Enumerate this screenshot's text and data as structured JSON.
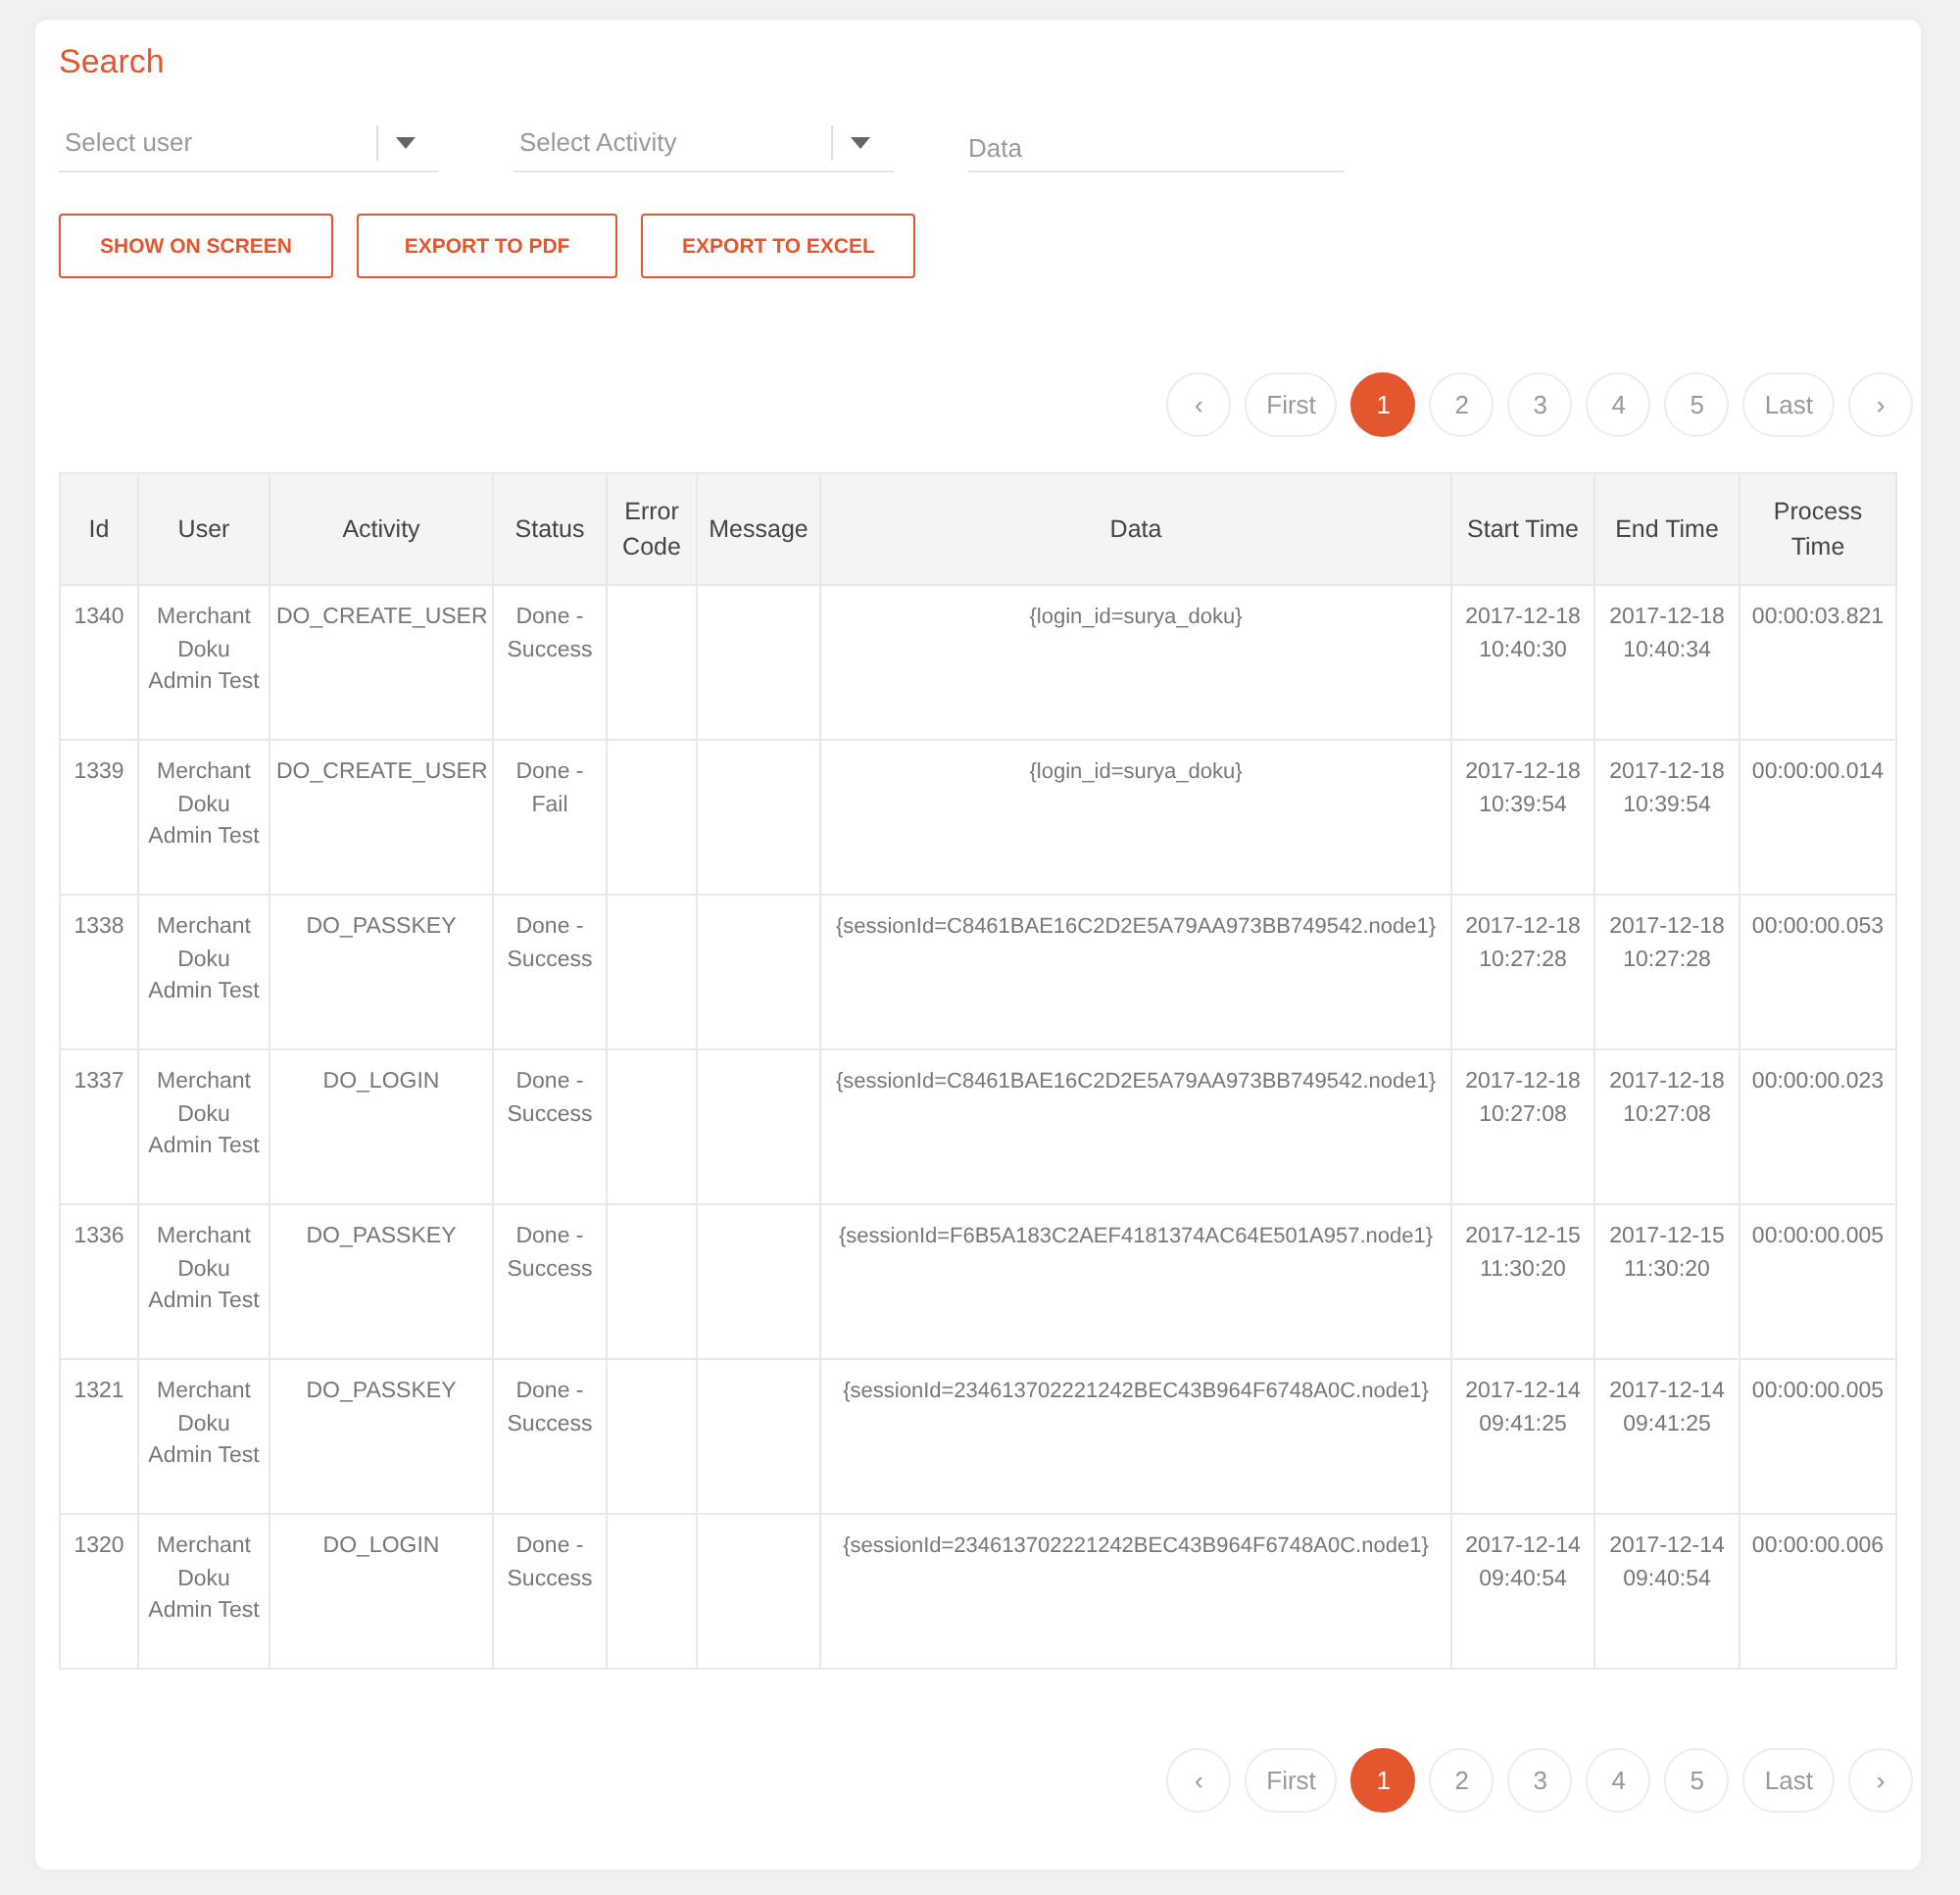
{
  "search": {
    "title": "Search",
    "fields": [
      {
        "kind": "select",
        "placeholder": "Select user"
      },
      {
        "kind": "select",
        "placeholder": "Select Activity"
      },
      {
        "kind": "text",
        "placeholder": "Data"
      }
    ],
    "buttons": [
      "SHOW ON SCREEN",
      "EXPORT TO PDF",
      "EXPORT TO EXCEL"
    ]
  },
  "pagination_top": [
    {
      "label": "‹",
      "selected": false
    },
    {
      "label": "First",
      "selected": false
    },
    {
      "label": "1",
      "selected": true
    },
    {
      "label": "2",
      "selected": false
    },
    {
      "label": "3",
      "selected": false
    },
    {
      "label": "4",
      "selected": false
    },
    {
      "label": "5",
      "selected": false
    },
    {
      "label": "Last",
      "selected": false
    },
    {
      "label": "›",
      "selected": false
    }
  ],
  "table": {
    "columns": [
      "Id",
      "User",
      "Activity",
      "Status",
      "Error Code",
      "Message",
      "Data",
      "Start Time",
      "End Time",
      "Process Time"
    ],
    "rows": [
      [
        "1340",
        "Merchant Doku Admin Test",
        "DO_CREATE_USER",
        "Done - Success",
        "",
        "",
        "{login_id=surya_doku}",
        "2017-12-18 10:40:30",
        "2017-12-18 10:40:34",
        "00:00:03.821"
      ],
      [
        "1339",
        "Merchant Doku Admin Test",
        "DO_CREATE_USER",
        "Done - Fail",
        "",
        "",
        "{login_id=surya_doku}",
        "2017-12-18 10:39:54",
        "2017-12-18 10:39:54",
        "00:00:00.014"
      ],
      [
        "1338",
        "Merchant Doku Admin Test",
        "DO_PASSKEY",
        "Done - Success",
        "",
        "",
        "{sessionId=C8461BAE16C2D2E5A79AA973BB749542.node1}",
        "2017-12-18 10:27:28",
        "2017-12-18 10:27:28",
        "00:00:00.053"
      ],
      [
        "1337",
        "Merchant Doku Admin Test",
        "DO_LOGIN",
        "Done - Success",
        "",
        "",
        "{sessionId=C8461BAE16C2D2E5A79AA973BB749542.node1}",
        "2017-12-18 10:27:08",
        "2017-12-18 10:27:08",
        "00:00:00.023"
      ],
      [
        "1336",
        "Merchant Doku Admin Test",
        "DO_PASSKEY",
        "Done - Success",
        "",
        "",
        "{sessionId=F6B5A183C2AEF4181374AC64E501A957.node1}",
        "2017-12-15 11:30:20",
        "2017-12-15 11:30:20",
        "00:00:00.005"
      ],
      [
        "1321",
        "Merchant Doku Admin Test",
        "DO_PASSKEY",
        "Done - Success",
        "",
        "",
        "{sessionId=234613702221242BEC43B964F6748A0C.node1}",
        "2017-12-14 09:41:25",
        "2017-12-14 09:41:25",
        "00:00:00.005"
      ],
      [
        "1320",
        "Merchant Doku Admin Test",
        "DO_LOGIN",
        "Done - Success",
        "",
        "",
        "{sessionId=234613702221242BEC43B964F6748A0C.node1}",
        "2017-12-14 09:40:54",
        "2017-12-14 09:40:54",
        "00:00:00.006"
      ]
    ]
  },
  "pagination_bottom": [
    {
      "label": "‹",
      "selected": false
    },
    {
      "label": "First",
      "selected": false
    },
    {
      "label": "1",
      "selected": true
    },
    {
      "label": "2",
      "selected": false
    },
    {
      "label": "3",
      "selected": false
    },
    {
      "label": "4",
      "selected": false
    },
    {
      "label": "5",
      "selected": false
    },
    {
      "label": "Last",
      "selected": false
    },
    {
      "label": "›",
      "selected": false
    }
  ]
}
